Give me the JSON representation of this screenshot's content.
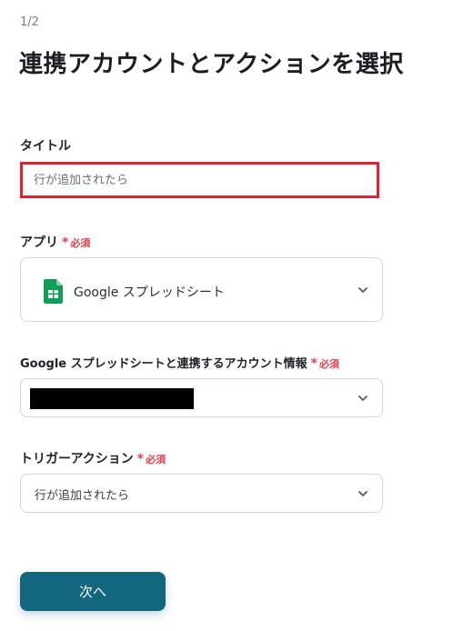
{
  "step": "1/2",
  "page_title": "連携アカウントとアクションを選択",
  "required_mark": "*",
  "required_text": "必須",
  "fields": {
    "title": {
      "label": "タイトル",
      "placeholder": "行が追加されたら"
    },
    "app": {
      "label": "アプリ",
      "value": "Google スプレッドシート",
      "icon": "google-sheets-icon"
    },
    "account": {
      "label": "Google スプレッドシートと連携するアカウント情報",
      "value_redacted": true
    },
    "trigger": {
      "label": "トリガーアクション",
      "value": "行が追加されたら"
    }
  },
  "next_button": "次へ",
  "colors": {
    "accent": "#12667e",
    "required": "#e0404f",
    "highlight_border": "#e02130",
    "sheets_green": "#0f9d58"
  }
}
